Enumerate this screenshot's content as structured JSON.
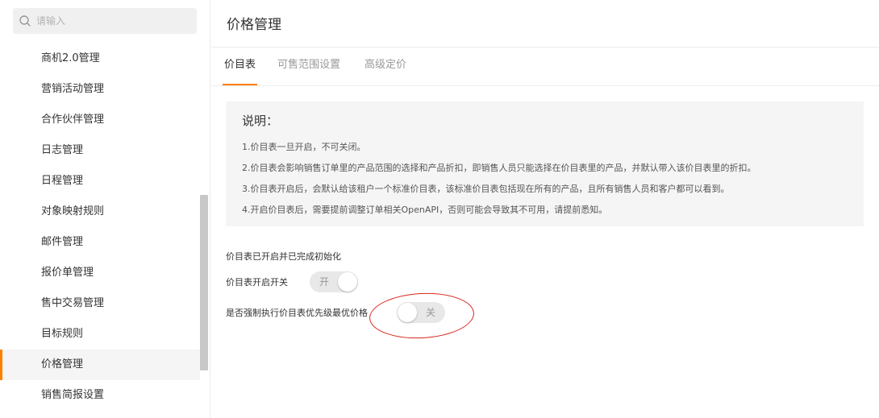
{
  "sidebar": {
    "search_placeholder": "请输入",
    "items": [
      {
        "label": "商机2.0管理"
      },
      {
        "label": "营销活动管理"
      },
      {
        "label": "合作伙伴管理"
      },
      {
        "label": "日志管理"
      },
      {
        "label": "日程管理"
      },
      {
        "label": "对象映射规则"
      },
      {
        "label": "邮件管理"
      },
      {
        "label": "报价单管理"
      },
      {
        "label": "售中交易管理"
      },
      {
        "label": "目标规则"
      },
      {
        "label": "价格管理",
        "active": true
      },
      {
        "label": "销售简报设置"
      }
    ]
  },
  "main": {
    "title": "价格管理",
    "tabs": [
      {
        "label": "价目表",
        "active": true
      },
      {
        "label": "可售范围设置"
      },
      {
        "label": "高级定价"
      }
    ],
    "note": {
      "title": "说明：",
      "lines": [
        "1.价目表一旦开启，不可关闭。",
        "2.价目表会影响销售订单里的产品范围的选择和产品折扣，即销售人员只能选择在价目表里的产品，并默认带入该价目表里的折扣。",
        "3.价目表开启后，会默认给该租户一个标准价目表，该标准价目表包括现在所有的产品，且所有销售人员和客户都可以看到。",
        "4.开启价目表后，需要提前调整订单相关OpenAPI，否则可能会导致其不可用，请提前悉知。"
      ]
    },
    "status_text": "价目表已开启并已完成初始化",
    "settings": [
      {
        "label": "价目表开启开关",
        "state_text": "开",
        "on": true
      },
      {
        "label": "是否强制执行价目表优先级最优价格",
        "state_text": "关",
        "on": false
      }
    ]
  },
  "colors": {
    "accent": "#ff8000",
    "annotation": "#d9251d"
  }
}
